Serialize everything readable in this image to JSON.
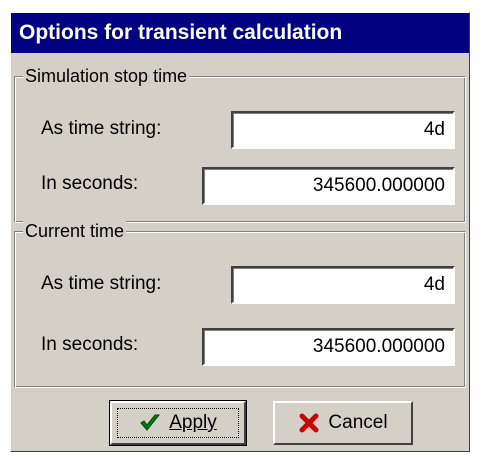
{
  "dialog": {
    "title": "Options for transient calculation"
  },
  "stop_group": {
    "title": "Simulation stop time",
    "time_string_label": "As time string:",
    "time_string_value": "4d",
    "seconds_label": "In seconds:",
    "seconds_value": "345600.000000"
  },
  "current_group": {
    "title": "Current time",
    "time_string_label": "As time string:",
    "time_string_value": "4d",
    "seconds_label": "In seconds:",
    "seconds_value": "345600.000000"
  },
  "buttons": {
    "apply_label": "Apply",
    "apply_icon": "checkmark-icon",
    "cancel_label": "Cancel",
    "cancel_icon": "x-icon"
  },
  "colors": {
    "title_bar": "#000080",
    "dialog_bg": "#d4d0c8",
    "check_green": "#008000",
    "cancel_red": "#cc0000"
  }
}
